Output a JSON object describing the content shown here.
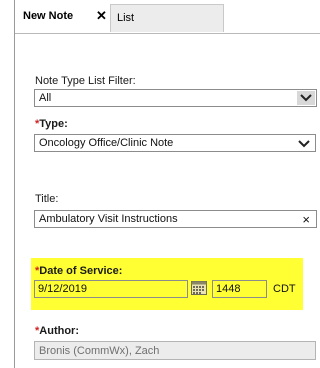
{
  "tabs": {
    "active_label": "New Note",
    "close_glyph": "✕",
    "list_label": "List"
  },
  "form": {
    "note_type_filter": {
      "label": "Note Type List Filter:",
      "value": "All"
    },
    "type": {
      "required_mark": "*",
      "label": "Type:",
      "value": "Oncology Office/Clinic Note"
    },
    "title": {
      "label": "Title:",
      "value": "Ambulatory Visit Instructions",
      "clear_glyph": "×"
    },
    "date_of_service": {
      "required_mark": "*",
      "label": "Date of Service:",
      "date_value": "9/12/2019",
      "time_value": "1448",
      "timezone": "CDT",
      "highlight_color": "#ffff33"
    },
    "author": {
      "required_mark": "*",
      "label": "Author:",
      "value": "Bronis (CommWx), Zach"
    }
  },
  "icons": {
    "filter_dropdown": "chevron-down-icon",
    "type_dropdown": "chevron-down-icon",
    "title_clear": "close-icon",
    "date_picker": "calendar-icon"
  }
}
